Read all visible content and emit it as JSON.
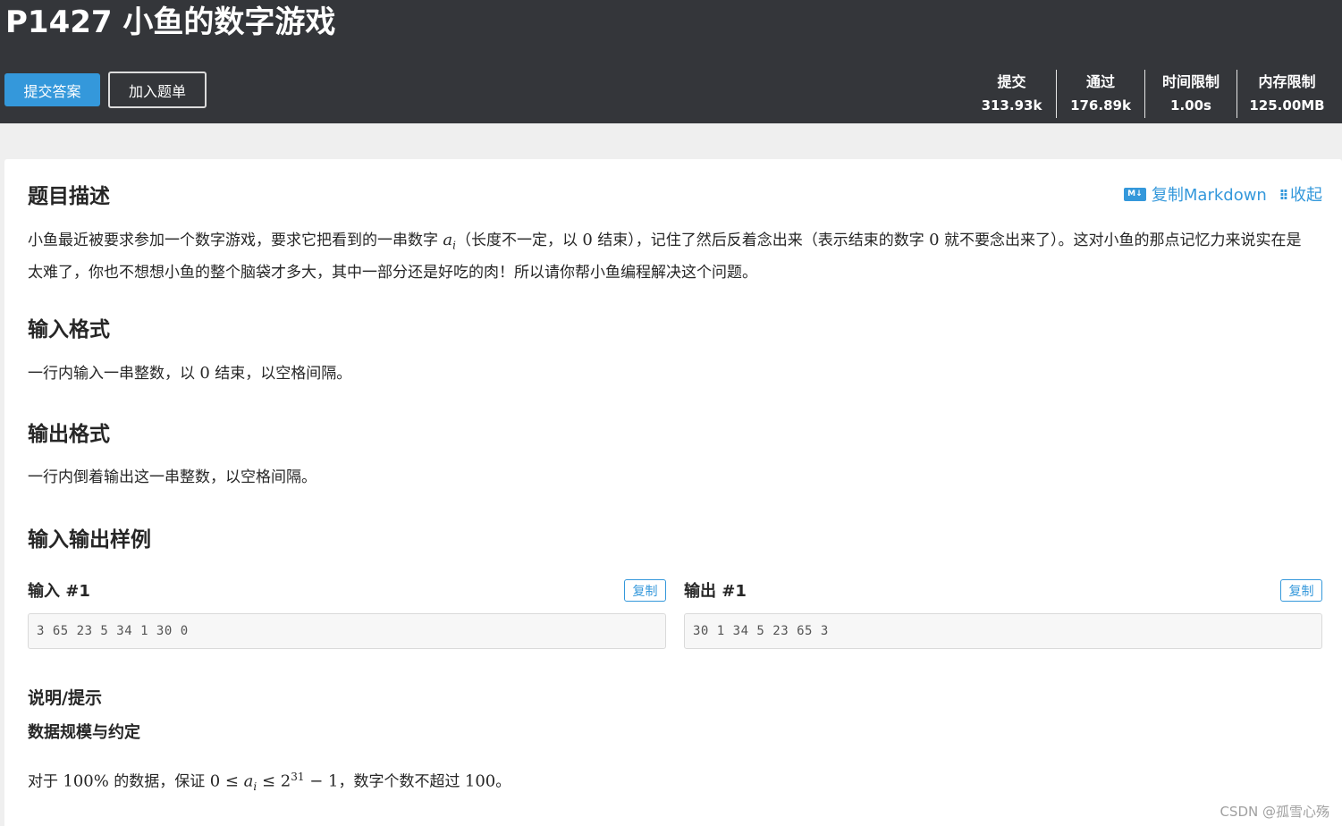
{
  "header": {
    "title": "P1427 小鱼的数字游戏",
    "submit_label": "提交答案",
    "add_list_label": "加入题单",
    "stats": [
      {
        "label": "提交",
        "value": "313.93k"
      },
      {
        "label": "通过",
        "value": "176.89k"
      },
      {
        "label": "时间限制",
        "value": "1.00s"
      },
      {
        "label": "内存限制",
        "value": "125.00MB"
      }
    ]
  },
  "toolbar": {
    "md_icon": "M↓",
    "copy_markdown": "复制Markdown",
    "collapse_icon": "⁝⁝",
    "collapse": "收起"
  },
  "description": {
    "heading": "题目描述",
    "p1": "小鱼最近被要求参加一个数字游戏，要求它把看到的一串数字 ",
    "m1": "a",
    "m1_sub": "i",
    "p2": "（长度不一定，以 ",
    "m2": "0",
    "p3": " 结束），记住了然后反着念出来（表示结束的数字 ",
    "m3": "0",
    "p4": " 就不要念出来了）。这对小鱼的那点记忆力来说实在是太难了，你也不想想小鱼的整个脑袋才多大，其中一部分还是好吃的肉！所以请你帮小鱼编程解决这个问题。"
  },
  "input_format": {
    "heading": "输入格式",
    "p1": "一行内输入一串整数，以 ",
    "m1": "0",
    "p2": " 结束，以空格间隔。"
  },
  "output_format": {
    "heading": "输出格式",
    "text": "一行内倒着输出这一串整数，以空格间隔。"
  },
  "samples": {
    "heading": "输入输出样例",
    "input_label": "输入 #1",
    "output_label": "输出 #1",
    "copy_label": "复制",
    "input_value": "3 65 23 5 34 1 30 0",
    "output_value": "30 1 34 5 23 65 3"
  },
  "hint": {
    "heading": "说明/提示",
    "subheading": "数据规模与约定",
    "p1": "对于 ",
    "m1": "100%",
    "p2": " 的数据，保证 ",
    "m2a": "0 ≤ ",
    "m2b": "a",
    "m2b_sub": "i",
    "m2c": " ≤ 2",
    "m2sup": "31",
    "m2d": " − 1",
    "p3": "，数字个数不超过 ",
    "m3": "100",
    "p4": "。"
  },
  "watermark": "CSDN @孤雪心殇"
}
